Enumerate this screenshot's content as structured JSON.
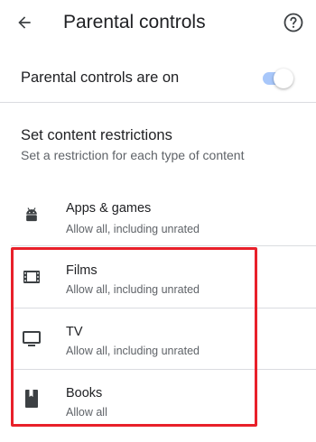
{
  "header": {
    "title": "Parental controls"
  },
  "toggle": {
    "label": "Parental controls are on",
    "state": "on",
    "track_color": "#a8c7fa"
  },
  "restrictions": {
    "title": "Set content restrictions",
    "subtitle": "Set a restriction for each type of content"
  },
  "items": [
    {
      "icon": "android-icon",
      "title": "Apps & games",
      "subtitle": "Allow all, including unrated"
    },
    {
      "icon": "film-icon",
      "title": "Films",
      "subtitle": "Allow all, including unrated"
    },
    {
      "icon": "tv-icon",
      "title": "TV",
      "subtitle": "Allow all, including unrated"
    },
    {
      "icon": "book-icon",
      "title": "Books",
      "subtitle": "Allow all"
    }
  ],
  "colors": {
    "highlight": "#e8202a",
    "text_primary": "#202124",
    "text_secondary": "#5f6368",
    "divider": "#dadce0"
  }
}
